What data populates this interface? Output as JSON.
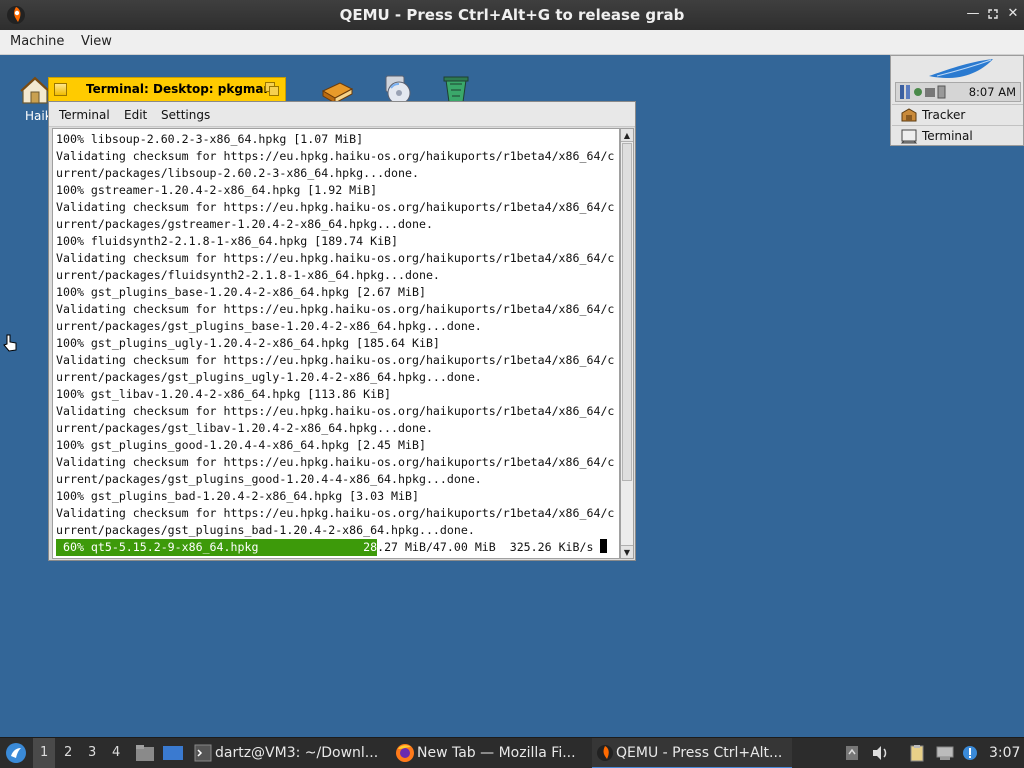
{
  "window": {
    "title": "QEMU - Press Ctrl+Alt+G to release grab",
    "controls": [
      "minimize-icon",
      "maximize-icon",
      "close-icon"
    ]
  },
  "menubar": {
    "items": [
      "Machine",
      "View"
    ]
  },
  "desktop": {
    "icons": [
      {
        "name": "home-folder-icon",
        "label": "Haik"
      },
      {
        "name": "books-icon",
        "label": ""
      },
      {
        "name": "disk-icon",
        "label": ""
      },
      {
        "name": "trash-icon",
        "label": ""
      }
    ]
  },
  "terminal": {
    "tab_title": "Terminal: Desktop: pkgman",
    "menu": [
      "Terminal",
      "Edit",
      "Settings"
    ],
    "lines": [
      "100% libsoup-2.60.2-3-x86_64.hpkg [1.07 MiB]",
      "Validating checksum for https://eu.hpkg.haiku-os.org/haikuports/r1beta4/x86_64/c",
      "urrent/packages/libsoup-2.60.2-3-x86_64.hpkg...done.",
      "100% gstreamer-1.20.4-2-x86_64.hpkg [1.92 MiB]",
      "Validating checksum for https://eu.hpkg.haiku-os.org/haikuports/r1beta4/x86_64/c",
      "urrent/packages/gstreamer-1.20.4-2-x86_64.hpkg...done.",
      "100% fluidsynth2-2.1.8-1-x86_64.hpkg [189.74 KiB]",
      "Validating checksum for https://eu.hpkg.haiku-os.org/haikuports/r1beta4/x86_64/c",
      "urrent/packages/fluidsynth2-2.1.8-1-x86_64.hpkg...done.",
      "100% gst_plugins_base-1.20.4-2-x86_64.hpkg [2.67 MiB]",
      "Validating checksum for https://eu.hpkg.haiku-os.org/haikuports/r1beta4/x86_64/c",
      "urrent/packages/gst_plugins_base-1.20.4-2-x86_64.hpkg...done.",
      "100% gst_plugins_ugly-1.20.4-2-x86_64.hpkg [185.64 KiB]",
      "Validating checksum for https://eu.hpkg.haiku-os.org/haikuports/r1beta4/x86_64/c",
      "urrent/packages/gst_plugins_ugly-1.20.4-2-x86_64.hpkg...done.",
      "100% gst_libav-1.20.4-2-x86_64.hpkg [113.86 KiB]",
      "Validating checksum for https://eu.hpkg.haiku-os.org/haikuports/r1beta4/x86_64/c",
      "urrent/packages/gst_libav-1.20.4-2-x86_64.hpkg...done.",
      "100% gst_plugins_good-1.20.4-4-x86_64.hpkg [2.45 MiB]",
      "Validating checksum for https://eu.hpkg.haiku-os.org/haikuports/r1beta4/x86_64/c",
      "urrent/packages/gst_plugins_good-1.20.4-4-x86_64.hpkg...done.",
      "100% gst_plugins_bad-1.20.4-2-x86_64.hpkg [3.03 MiB]",
      "Validating checksum for https://eu.hpkg.haiku-os.org/haikuports/r1beta4/x86_64/c",
      "urrent/packages/gst_plugins_bad-1.20.4-2-x86_64.hpkg...done."
    ],
    "progress": {
      "fill_fraction": 0.6,
      "text_on_fill": " 60% qt5-5.15.2-9-x86_64.hpkg               28",
      "text_rest": ".27 MiB/47.00 MiB  325.26 KiB/s "
    },
    "colors": {
      "progress": "#3d9a0a",
      "tab": "#ffcb00"
    }
  },
  "deskbar": {
    "clock": "8:07 AM",
    "items": [
      {
        "name": "tracker",
        "label": "Tracker"
      },
      {
        "name": "terminal",
        "label": "Terminal"
      }
    ]
  },
  "taskbar": {
    "workspaces": [
      "1",
      "2",
      "3",
      "4"
    ],
    "tasks": [
      {
        "name": "terminal",
        "label": "dartz@VM3: ~/Downl..."
      },
      {
        "name": "firefox",
        "label": "New Tab — Mozilla Fi..."
      },
      {
        "name": "qemu",
        "label": "QEMU - Press Ctrl+Alt..."
      }
    ],
    "clock": "3:07"
  }
}
